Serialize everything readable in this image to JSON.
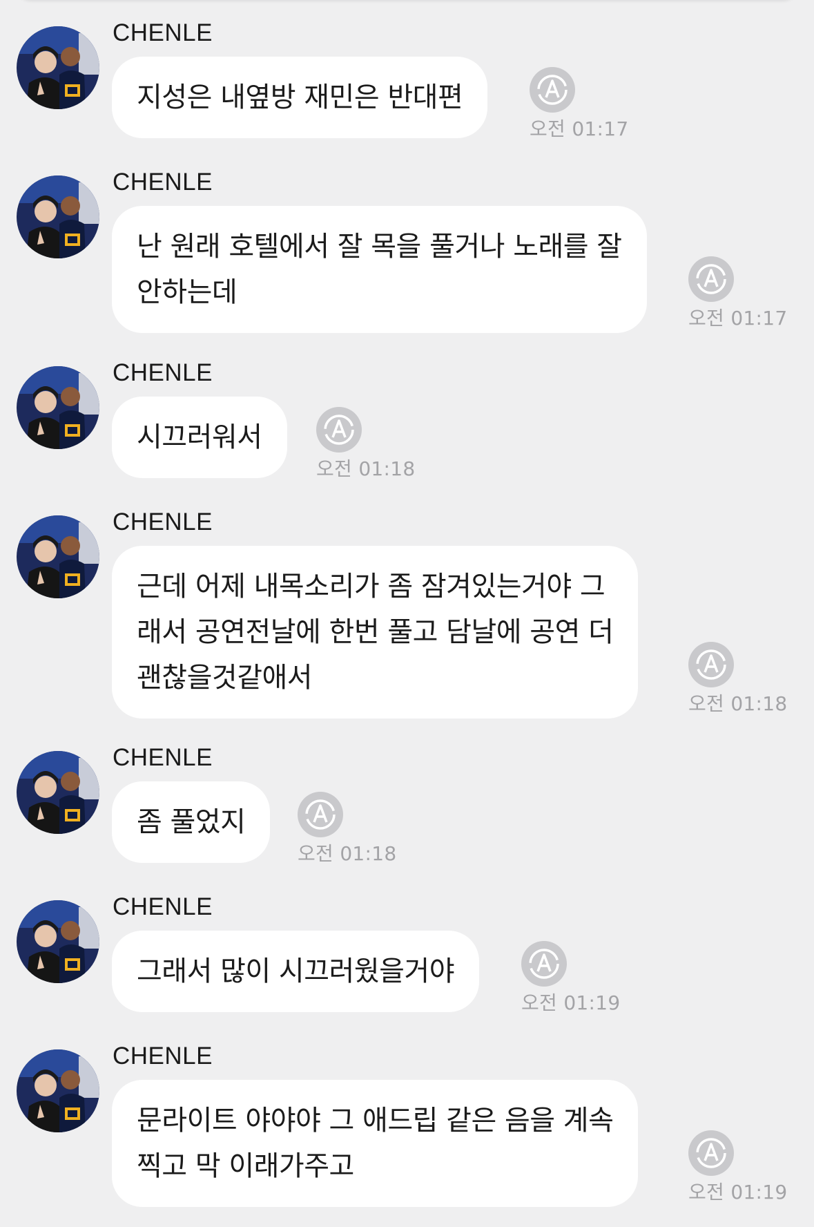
{
  "messages": [
    {
      "sender": "CHENLE",
      "lines": [
        "지성은 내옆방 재민은 반대편"
      ],
      "time": "오전 01:17"
    },
    {
      "sender": "CHENLE",
      "lines": [
        "난 원래 호텔에서 잘 목을 풀거나 노래를 잘",
        "안하는데"
      ],
      "time": "오전 01:17"
    },
    {
      "sender": "CHENLE",
      "lines": [
        "시끄러워서"
      ],
      "time": "오전 01:18"
    },
    {
      "sender": "CHENLE",
      "lines": [
        "근데 어제 내목소리가 좀 잠겨있는거야 그",
        "래서 공연전날에 한번 풀고 담날에 공연 더",
        "괜찮을것같애서"
      ],
      "time": "오전 01:18"
    },
    {
      "sender": "CHENLE",
      "lines": [
        "좀 풀었지"
      ],
      "time": "오전 01:18"
    },
    {
      "sender": "CHENLE",
      "lines": [
        "그래서 많이 시끄러웠을거야"
      ],
      "time": "오전 01:19"
    },
    {
      "sender": "CHENLE",
      "lines": [
        "문라이트 야야야 그 애드립 같은 음을 계속",
        "찍고 막 이래가주고"
      ],
      "time": "오전 01:19"
    }
  ],
  "icons": {
    "avatar": "profile-photo",
    "translate": "auto-translate-icon"
  },
  "colors": {
    "background": "#efeff0",
    "bubble": "#ffffff",
    "translate_icon": "#c9c9cc",
    "time_text": "#a3a3a6"
  }
}
